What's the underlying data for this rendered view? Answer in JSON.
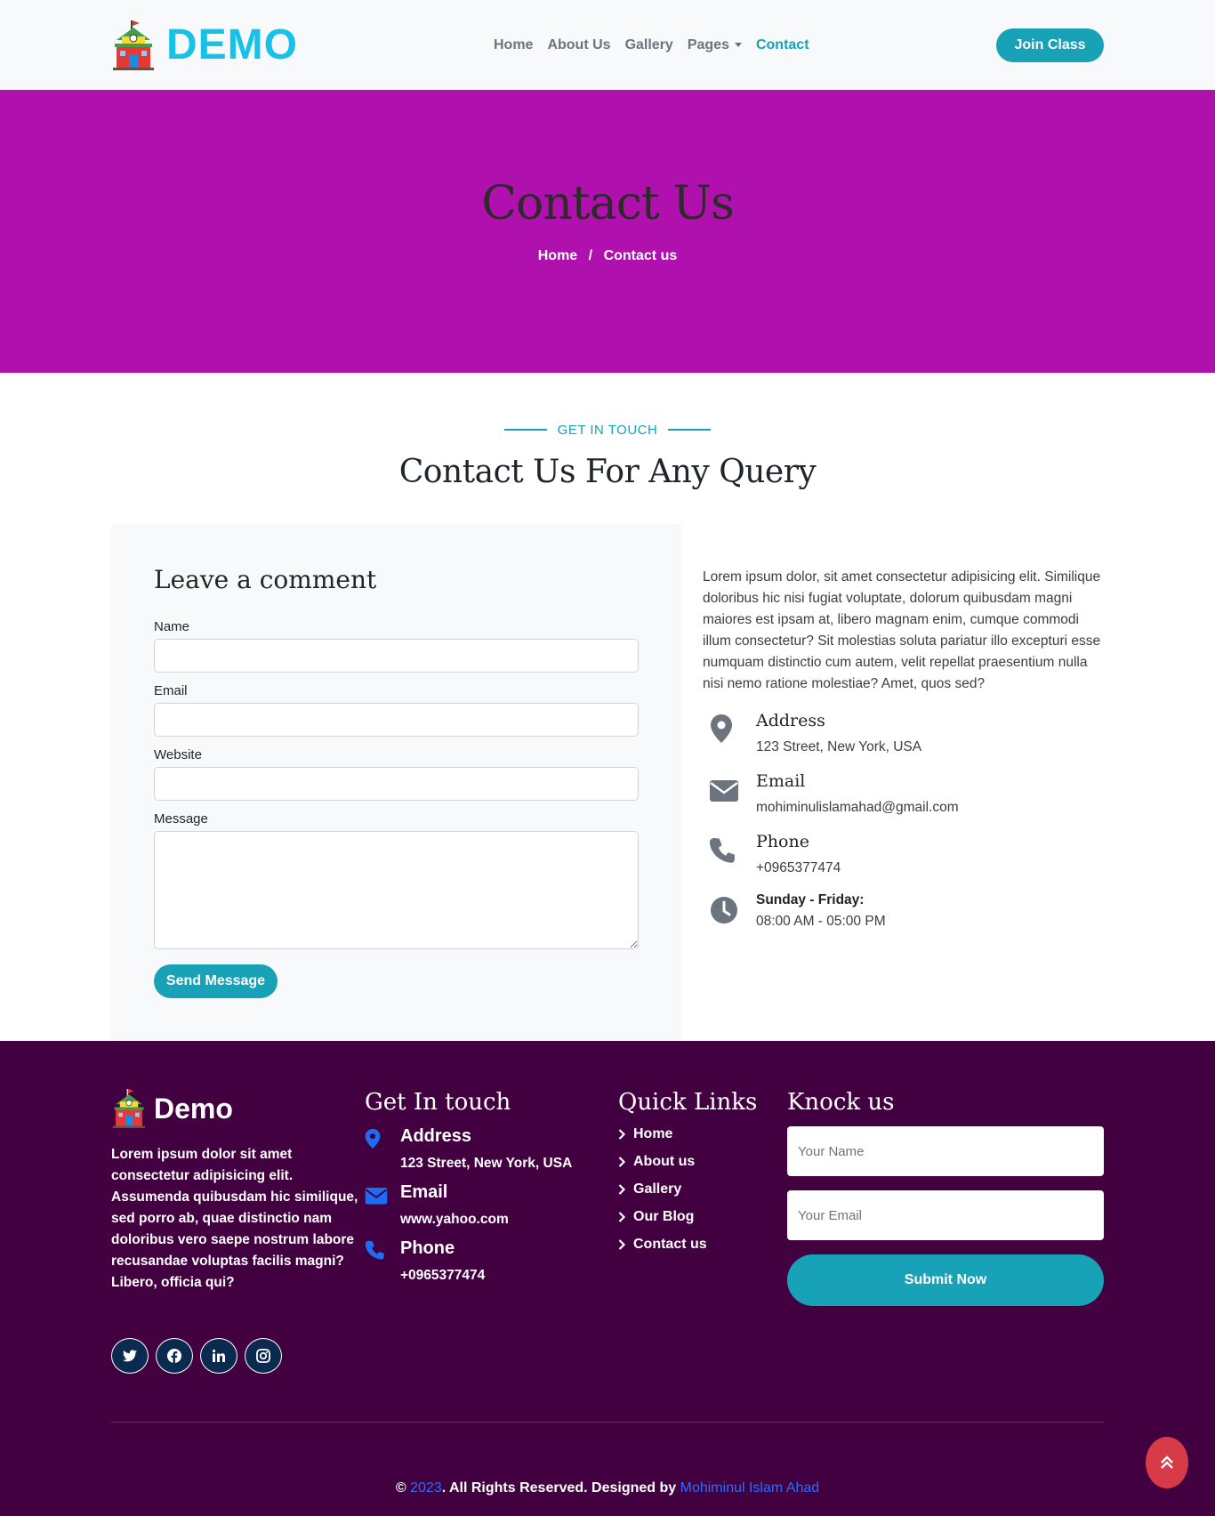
{
  "brand": {
    "name": "DEMO"
  },
  "nav": {
    "items": [
      "Home",
      "About Us",
      "Gallery",
      "Pages",
      "Contact"
    ],
    "active": "Contact",
    "cta": "Join Class"
  },
  "hero": {
    "title": "Contact Us",
    "breadcrumb": [
      "Home",
      "/",
      "Contact us"
    ]
  },
  "section": {
    "eyebrow": "GET IN TOUCH",
    "title": "Contact Us For Any Query"
  },
  "form": {
    "heading": "Leave a comment",
    "labels": {
      "name": "Name",
      "email": "Email",
      "website": "Website",
      "message": "Message"
    },
    "submit": "Send Message"
  },
  "info": {
    "text": "Lorem ipsum dolor, sit amet consectetur adipisicing elit. Similique doloribus hic nisi fugiat voluptate, dolorum quibusdam magni maiores est ipsam at, libero magnam enim, cumque commodi illum consectetur? Sit molestias soluta pariatur illo excepturi esse numquam distinctio cum autem, velit repellat praesentium nulla nisi nemo ratione molestiae? Amet, quos sed?",
    "address": {
      "label": "Address",
      "value": "123 Street, New York, USA"
    },
    "email": {
      "label": "Email",
      "value": "mohiminulislamahad@gmail.com"
    },
    "phone": {
      "label": "Phone",
      "value": "+0965377474"
    },
    "hours": {
      "label": "Sunday - Friday:",
      "value": "08:00 AM - 05:00 PM"
    }
  },
  "footer": {
    "brand": "Demo",
    "about": "Lorem ipsum dolor sit amet consectetur adipisicing elit. Assumenda quibusdam hic similique, sed porro ab, quae distinctio nam doloribus vero saepe nostrum labore recusandae voluptas facilis magni? Libero, officia qui?",
    "get_in_touch": {
      "title": "Get In touch",
      "address_label": "Address",
      "address": "123 Street, New York, USA",
      "email_label": "Email",
      "email": "www.yahoo.com",
      "phone_label": "Phone",
      "phone": "+0965377474"
    },
    "quick_links": {
      "title": "Quick Links",
      "items": [
        "Home",
        "About us",
        "Gallery",
        "Our Blog",
        "Contact us"
      ]
    },
    "knock": {
      "title": "Knock us",
      "name_placeholder": "Your Name",
      "email_placeholder": "Your Email",
      "submit": "Submit Now"
    },
    "socials": [
      "twitter-icon",
      "facebook-icon",
      "linkedin-icon",
      "instagram-icon"
    ],
    "copyright": {
      "prefix": "©",
      "year": "2023",
      "middle": ". All Rights Reserved. Designed by",
      "author": "Mohiminul Islam Ahad"
    }
  },
  "colors": {
    "accent": "#17a2b8",
    "hero": "#b010ae",
    "footer": "#420040",
    "back_to_top": "#d63b47"
  }
}
